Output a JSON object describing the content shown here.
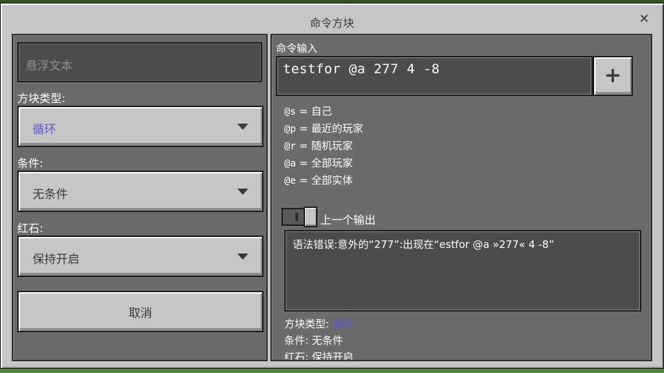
{
  "window": {
    "title": "命令方块"
  },
  "left": {
    "hover_placeholder": "悬浮文本",
    "block_type_label": "方块类型:",
    "block_type_value": "循环",
    "condition_label": "条件:",
    "condition_value": "无条件",
    "redstone_label": "红石:",
    "redstone_value": "保持开启",
    "cancel_label": "取消"
  },
  "right": {
    "command_input_label": "命令输入",
    "command_value": "testfor @a 277 4 -8",
    "plus_label": "+",
    "selectors": [
      {
        "key": "@s",
        "desc": "= 自己"
      },
      {
        "key": "@p",
        "desc": "= 最近的玩家"
      },
      {
        "key": "@r",
        "desc": "= 随机玩家"
      },
      {
        "key": "@a",
        "desc": "= 全部玩家"
      },
      {
        "key": "@e",
        "desc": "= 全部实体"
      }
    ],
    "previous_output_label": "上一个输出",
    "output_text": "语法错误:意外的“277”:出现在“estfor @a »277« 4 -8”",
    "summary": {
      "block_type_label": "方块类型:",
      "block_type_value": "循环",
      "condition_label": "条件:",
      "condition_value": "无条件",
      "redstone_label": "红石:",
      "redstone_value": "保持开启"
    }
  },
  "colors": {
    "accent_purple": "#5a56d6",
    "panel_dark": "#6b6b6b",
    "button_gray": "#c6c6c6"
  },
  "icons": {
    "close": "close-icon",
    "dropdown": "chevron-down-icon",
    "add": "plus-icon"
  }
}
